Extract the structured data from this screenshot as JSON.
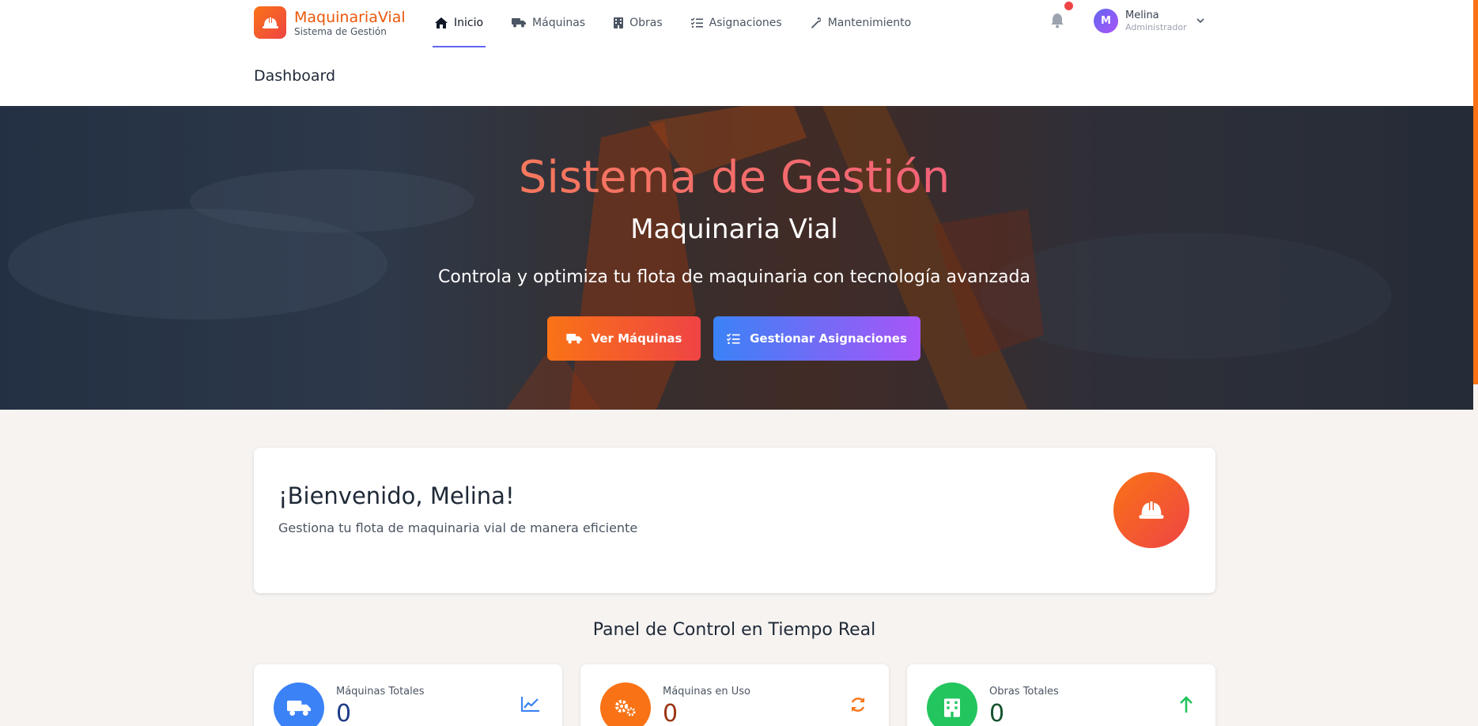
{
  "brand": {
    "name": "MaquinariaVial",
    "subtitle": "Sistema de Gestión"
  },
  "nav": [
    {
      "label": "Inicio",
      "icon": "home-icon",
      "active": true
    },
    {
      "label": "Máquinas",
      "icon": "truck-icon"
    },
    {
      "label": "Obras",
      "icon": "building-icon"
    },
    {
      "label": "Asignaciones",
      "icon": "checklist-icon"
    },
    {
      "label": "Mantenimiento",
      "icon": "wrench-icon"
    }
  ],
  "user": {
    "initial": "M",
    "name": "Melina",
    "role": "Administrador"
  },
  "page": {
    "title": "Dashboard"
  },
  "hero": {
    "title": "Sistema de Gestión",
    "subtitle": "Maquinaria Vial",
    "description": "Controla y optimiza tu flota de maquinaria con tecnología avanzada",
    "btn_machines": "Ver Máquinas",
    "btn_assign": "Gestionar Asignaciones"
  },
  "welcome": {
    "title": "¡Bienvenido, Melina!",
    "description": "Gestiona tu flota de maquinaria vial de manera eficiente"
  },
  "panel": {
    "title": "Panel de Control en Tiempo Real"
  },
  "stats": [
    {
      "label": "Máquinas Totales",
      "value": "0",
      "color": "#3b82f6",
      "value_color": "#1e3a8a",
      "icon": "truck-icon",
      "trend_icon": "chart-line-icon"
    },
    {
      "label": "Máquinas en Uso",
      "value": "0",
      "color": "#f97316",
      "value_color": "#9a3412",
      "icon": "gears-icon",
      "trend_icon": "sync-icon"
    },
    {
      "label": "Obras Totales",
      "value": "0",
      "color": "#22c55e",
      "value_color": "#14532d",
      "icon": "building-icon",
      "trend_icon": "arrow-up-icon"
    }
  ],
  "colors": {
    "accent": "#f97316",
    "nav_active": "#6366f1"
  }
}
